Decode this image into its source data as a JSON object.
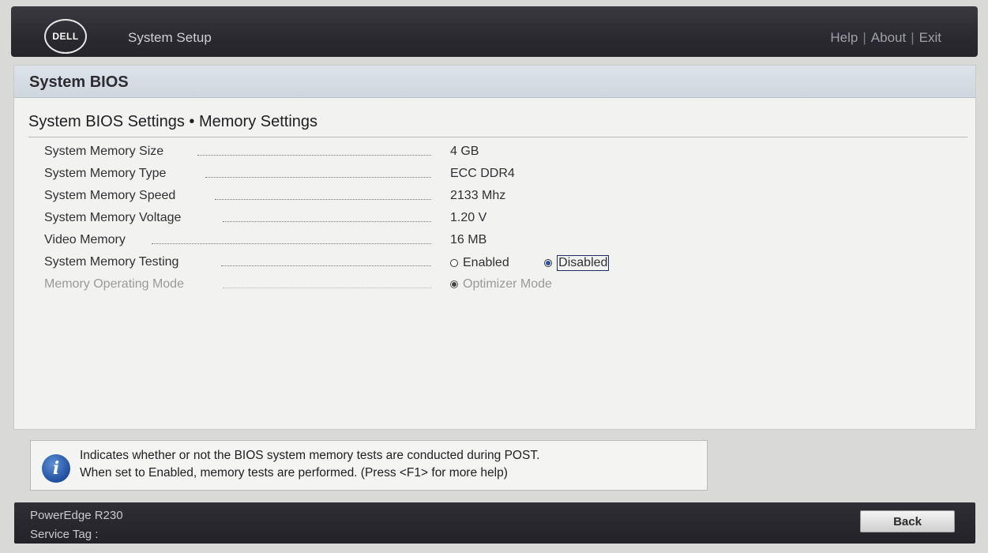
{
  "header": {
    "logo_text": "DELL",
    "app_title": "System Setup",
    "links": {
      "help": "Help",
      "about": "About",
      "exit": "Exit",
      "separator": "|"
    }
  },
  "panel": {
    "title": "System BIOS",
    "breadcrumb": "System BIOS Settings • Memory Settings"
  },
  "settings": [
    {
      "label": "System Memory Size",
      "value": "4 GB"
    },
    {
      "label": "System Memory Type",
      "value": "ECC DDR4"
    },
    {
      "label": "System Memory Speed",
      "value": "2133 Mhz"
    },
    {
      "label": "System Memory Voltage",
      "value": "1.20 V"
    },
    {
      "label": "Video Memory",
      "value": "16 MB"
    },
    {
      "label": "System Memory Testing",
      "options": [
        {
          "label": "Enabled",
          "selected": false
        },
        {
          "label": "Disabled",
          "selected": true
        }
      ]
    },
    {
      "label": "Memory Operating Mode",
      "disabled": true,
      "options": [
        {
          "label": "Optimizer Mode",
          "selected": true
        }
      ]
    }
  ],
  "help": {
    "icon": "info-icon",
    "line1": "Indicates whether or not the BIOS system memory tests are conducted during POST.",
    "line2": "When set to Enabled, memory tests are performed. (Press <F1> for more help)"
  },
  "footer": {
    "model": "PowerEdge R230",
    "service_tag_label": "Service Tag :",
    "back_label": "Back"
  },
  "colors": {
    "header_bg": "#2a2a30",
    "panel_header_bg": "#d6dce3",
    "panel_bg": "#f2f2f0",
    "radio_selected": "#2e4fa3",
    "info_icon": "#1f4f9e"
  }
}
